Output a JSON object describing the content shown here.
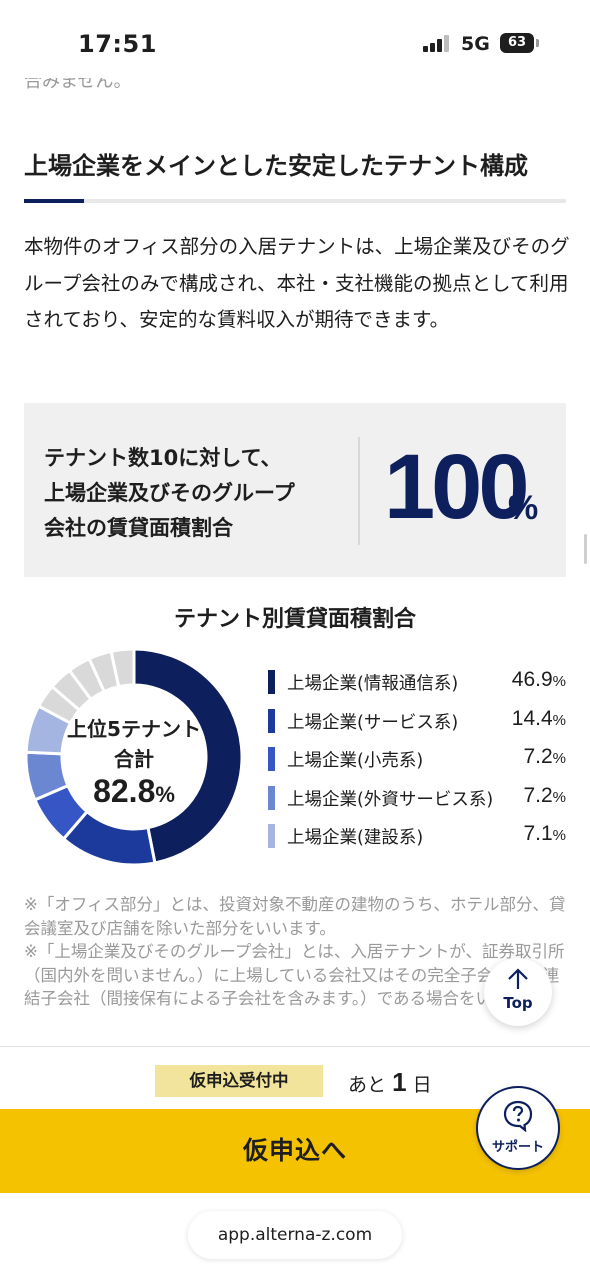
{
  "status_bar": {
    "time": "17:51",
    "network": "5G",
    "battery": "63"
  },
  "content": {
    "cut_text": "合みません。",
    "section_title": "上場企業をメインとした安定したテナント構成",
    "body": "本物件のオフィス部分の入居テナントは、上場企業及びそのグループ会社のみで構成され、本社・支社機能の拠点として利用されており、安定的な賃料収入が期待できます。",
    "stat": {
      "label_line1": "テナント数10に対して、",
      "label_line2": "上場企業及びそのグループ",
      "label_line3": "会社の賃貸面積割合",
      "value": "100",
      "unit": "%"
    },
    "notes": [
      "※「オフィス部分」とは、投資対象不動産の建物のうち、ホテル部分、貸会議室及び店舗を除いた部分をいいます。",
      "※「上場企業及びそのグループ会社」とは、入居テナントが、証券取引所（国内外を問いません。）に上場している会社又はその完全子会社及び連結子会社（間接保有による子会社を含みます。）である場合をいいます。"
    ]
  },
  "chart_data": {
    "type": "pie",
    "title": "テナント別賃貸面積割合",
    "center_label_line1": "上位5テナント",
    "center_label_line2": "合計",
    "center_value": "82.8",
    "center_unit": "%",
    "legend_placement": "right",
    "categories": [
      "上場企業(情報通信系)",
      "上場企業(サービス系)",
      "上場企業(小売系)",
      "上場企業(外資サービス系)",
      "上場企業(建設系)"
    ],
    "values": [
      46.9,
      14.4,
      7.2,
      7.2,
      7.1
    ],
    "value_labels": [
      "46.9",
      "14.4",
      "7.2",
      "7.2",
      "7.1"
    ],
    "unit": "%",
    "colors": [
      "#0d1f5c",
      "#1c3a9c",
      "#3556c4",
      "#6b87d2",
      "#a4b5e2"
    ],
    "other_segments": [
      3.5,
      3.5,
      3.4,
      3.4,
      3.4
    ],
    "other_colors": [
      "#d9d9d9",
      "#d9d9d9",
      "#d9d9d9",
      "#d9d9d9",
      "#d9d9d9"
    ]
  },
  "floating": {
    "top_label": "Top",
    "support_label": "サポート"
  },
  "footer": {
    "badge": "仮申込受付中",
    "remaining_prefix": "あと",
    "remaining_value": "1",
    "remaining_suffix": "日",
    "cta_label": "仮申込へ",
    "url": "app.alterna-z.com"
  }
}
